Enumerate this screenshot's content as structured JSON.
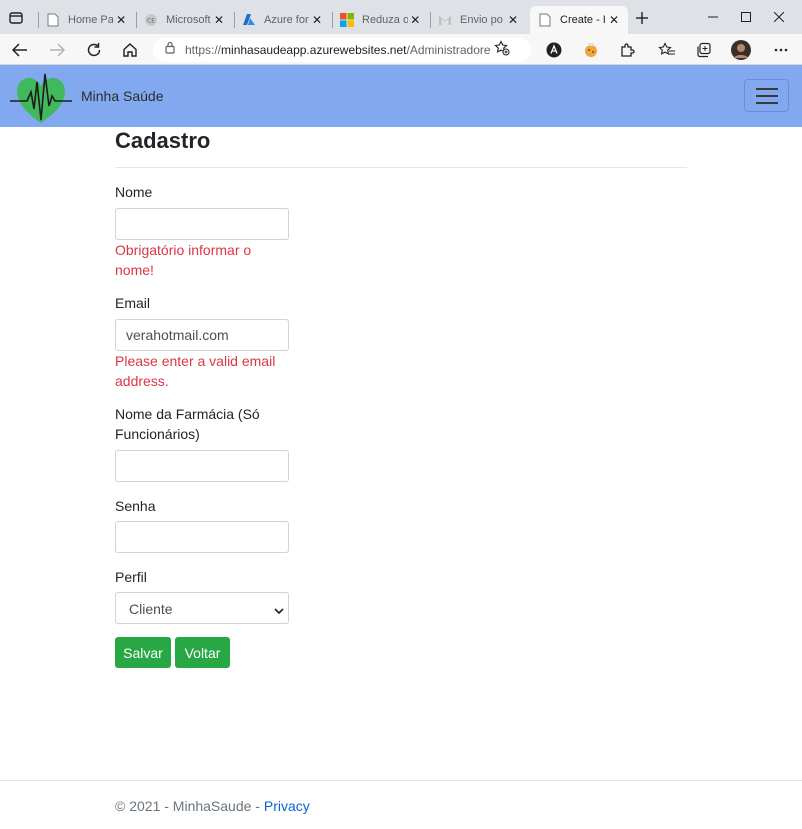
{
  "browser": {
    "tabs": [
      {
        "title": "Home Pa",
        "icon": "page-icon"
      },
      {
        "title": "Microsoft",
        "icon": "microsoft-icon"
      },
      {
        "title": "Azure for",
        "icon": "azure-icon"
      },
      {
        "title": "Reduza o",
        "icon": "microsoft-store-icon"
      },
      {
        "title": "Envio po",
        "icon": "gmail-icon"
      },
      {
        "title": "Create - I",
        "icon": "page-icon"
      }
    ],
    "close_glyph": "✕",
    "new_tab_glyph": "+",
    "url_prefix": "https://",
    "url_host": "minhasaudeapp.azurewebsites.net",
    "url_path": "/Administradore..."
  },
  "navbar": {
    "brand": "Minha Saúde",
    "colors": {
      "bar": "#82a9f0",
      "heart": "#3fb95b"
    }
  },
  "form": {
    "title": "Cadastro",
    "nome": {
      "label": "Nome",
      "value": "",
      "error": "Obrigatório informar o nome!"
    },
    "email": {
      "label": "Email",
      "value": "verahotmail.com",
      "error": "Please enter a valid email address."
    },
    "farmacia": {
      "label": "Nome da Farmácia (Só Funcionários)",
      "value": ""
    },
    "senha": {
      "label": "Senha",
      "value": ""
    },
    "perfil": {
      "label": "Perfil",
      "selected": "Cliente"
    },
    "buttons": {
      "save": "Salvar",
      "back": "Voltar"
    },
    "colors": {
      "error": "#dc3545",
      "button": "#28a745"
    }
  },
  "footer": {
    "text": "© 2021 - MinhaSaude - ",
    "privacy": "Privacy"
  }
}
